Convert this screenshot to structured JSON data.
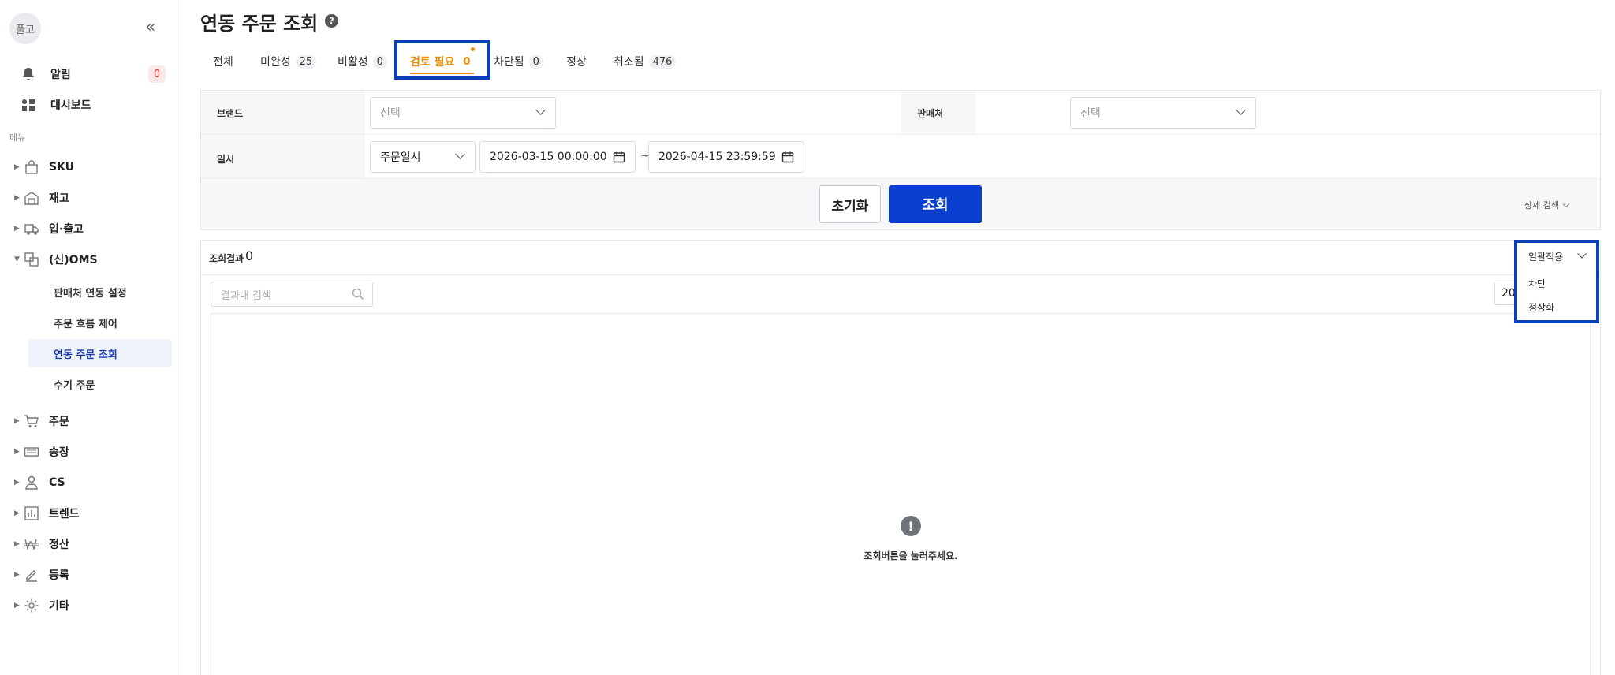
{
  "user": {
    "avatar_text": "풀고"
  },
  "sidebar": {
    "alarm_label": "알림",
    "alarm_count": "0",
    "dashboard_label": "대시보드",
    "menu_caption": "메뉴",
    "items": [
      {
        "label": "SKU",
        "icon": "bag-icon"
      },
      {
        "label": "재고",
        "icon": "warehouse-icon"
      },
      {
        "label": "입·출고",
        "icon": "truck-icon"
      },
      {
        "label": "(신)OMS",
        "icon": "sync-icon"
      },
      {
        "label": "주문",
        "icon": "cart-icon"
      },
      {
        "label": "송장",
        "icon": "keyboard-icon"
      },
      {
        "label": "CS",
        "icon": "person-icon"
      },
      {
        "label": "트렌드",
        "icon": "bar-chart-icon"
      },
      {
        "label": "정산",
        "icon": "won-icon"
      },
      {
        "label": "등록",
        "icon": "pencil-icon"
      },
      {
        "label": "기타",
        "icon": "gear-icon"
      }
    ],
    "oms_sub": [
      "판매처 연동 설정",
      "주문 흐름 제어",
      "연동 주문 조회",
      "수기 주문"
    ]
  },
  "page": {
    "title": "연동 주문 조회"
  },
  "tabs": [
    {
      "label": "전체",
      "count": ""
    },
    {
      "label": "미완성",
      "count": "25"
    },
    {
      "label": "비활성",
      "count": "0"
    },
    {
      "label": "검토 필요",
      "count": "0"
    },
    {
      "label": "차단됨",
      "count": "0"
    },
    {
      "label": "정상",
      "count": ""
    },
    {
      "label": "취소됨",
      "count": "476"
    }
  ],
  "filter": {
    "brand_label": "브랜드",
    "brand_placeholder": "선택",
    "seller_label": "판매처",
    "seller_placeholder": "선택",
    "date_label": "일시",
    "date_type": "주문일시",
    "date_from": "2026-03-15 00:00:00",
    "date_sep": "~",
    "date_to": "2026-04-15 23:59:59",
    "reset_label": "초기화",
    "search_label": "조회",
    "detail_label": "상세 검색"
  },
  "results": {
    "label": "조회결과",
    "count": "0",
    "search_placeholder": "결과내 검색",
    "page_size": "20",
    "empty_message": "조회버튼을 눌러주세요."
  },
  "bulk": {
    "label": "일괄적용",
    "options": [
      "차단",
      "정상화"
    ]
  },
  "colors": {
    "accent": "#0a3fcf",
    "active_tab": "#f08c00",
    "highlight": "#0a3fb5",
    "alert": "#e02424"
  }
}
